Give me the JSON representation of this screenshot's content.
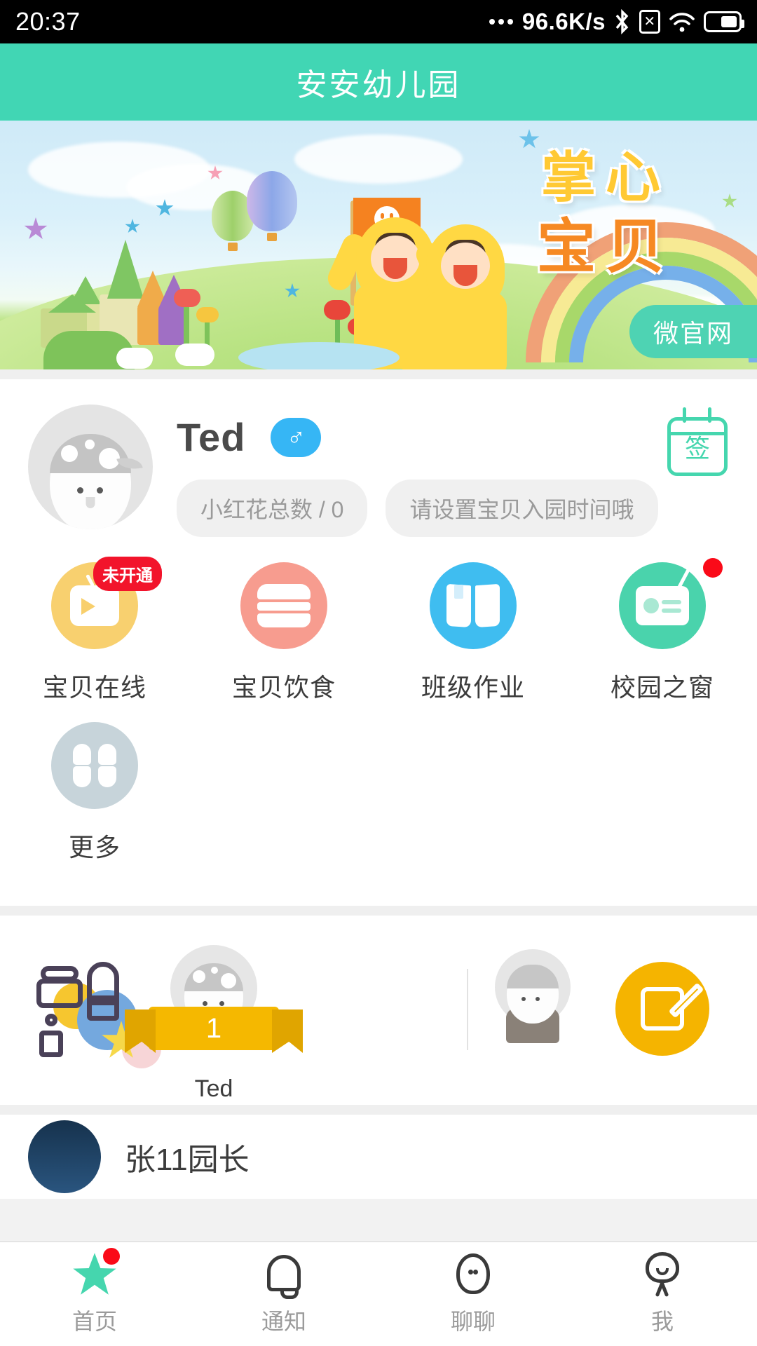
{
  "status_bar": {
    "time": "20:37",
    "network_speed": "96.6K/s",
    "icons": [
      "more-dots-icon",
      "bluetooth-icon",
      "sim-x-icon",
      "wifi-icon",
      "battery-icon"
    ]
  },
  "header": {
    "title": "安安幼儿园"
  },
  "banner": {
    "title_line1": "掌心",
    "title_line2": "宝贝",
    "website_button": "微官网"
  },
  "profile": {
    "name": "Ted",
    "gender_symbol": "♂",
    "sign_button_label": "签",
    "pills": [
      "小红花总数 / 0",
      "请设置宝贝入园时间哦"
    ]
  },
  "grid": {
    "items": [
      {
        "label": "宝贝在线",
        "icon": "tv-icon",
        "color": "#f8d06f",
        "badge": "未开通",
        "dot": false
      },
      {
        "label": "宝贝饮食",
        "icon": "burger-icon",
        "color": "#f79c8f",
        "badge": "",
        "dot": false
      },
      {
        "label": "班级作业",
        "icon": "book-icon",
        "color": "#3fbdf0",
        "badge": "",
        "dot": false
      },
      {
        "label": "校园之窗",
        "icon": "radio-icon",
        "color": "#4ad3ac",
        "badge": "",
        "dot": true
      },
      {
        "label": "更多",
        "icon": "grid-icon",
        "color": "#c7d4da",
        "badge": "",
        "dot": false
      }
    ]
  },
  "rank": {
    "rank_number": "1",
    "child_name": "Ted",
    "compose_button": "compose-icon"
  },
  "list": {
    "rows": [
      {
        "name": "张11园长"
      }
    ]
  },
  "bottom_nav": {
    "items": [
      {
        "label": "首页",
        "icon": "star-icon",
        "active": true,
        "dot": true
      },
      {
        "label": "通知",
        "icon": "bell-icon",
        "active": false,
        "dot": false
      },
      {
        "label": "聊聊",
        "icon": "chat-face-icon",
        "active": false,
        "dot": false
      },
      {
        "label": "我",
        "icon": "person-icon",
        "active": false,
        "dot": false
      }
    ]
  },
  "colors": {
    "brand_teal": "#41d6b4",
    "accent_yellow": "#f5b400",
    "badge_red": "#f2142b",
    "banner_title1": "#ffc933",
    "banner_title2": "#f68923"
  }
}
